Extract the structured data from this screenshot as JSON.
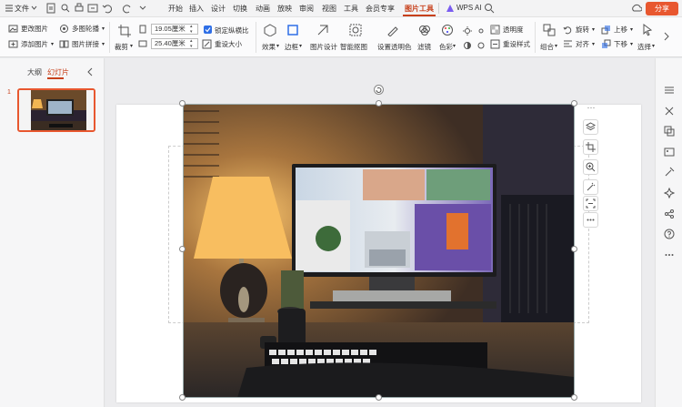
{
  "menubar": {
    "file_label": "文件",
    "tabs": [
      "开始",
      "插入",
      "设计",
      "切换",
      "动画",
      "放映",
      "审阅",
      "视图",
      "工具",
      "会员专享",
      "图片工具"
    ],
    "active_tab": "图片工具",
    "wps_ai_label": "WPS AI",
    "share_label": "分享"
  },
  "ribbon": {
    "change_picture": "更改图片",
    "add_picture": "添加图片",
    "multi_crop": "多图轮播",
    "picture_stitch": "图片拼接",
    "crop": "裁剪",
    "height_value": "19.05厘米",
    "width_value": "25.40厘米",
    "lock_ratio": "锁定纵横比",
    "reset_size": "重设大小",
    "effects": "效果",
    "border": "边框",
    "picture_design": "图片设计",
    "smart_cutout": "智能抠图",
    "set_transparent": "设置透明色",
    "filter": "滤镜",
    "color": "色彩",
    "transparency": "透明度",
    "reset_style": "重设样式",
    "group": "组合",
    "rotate": "旋转",
    "align": "对齐",
    "move_up": "上移",
    "move_down": "下移",
    "select": "选择"
  },
  "leftpane": {
    "tab_outline": "大纲",
    "tab_slides": "幻灯片",
    "slide_number": "1"
  },
  "colors": {
    "accent": "#e8572f",
    "accent_text": "#c7401b",
    "checkbox_blue": "#2e6ee6"
  }
}
